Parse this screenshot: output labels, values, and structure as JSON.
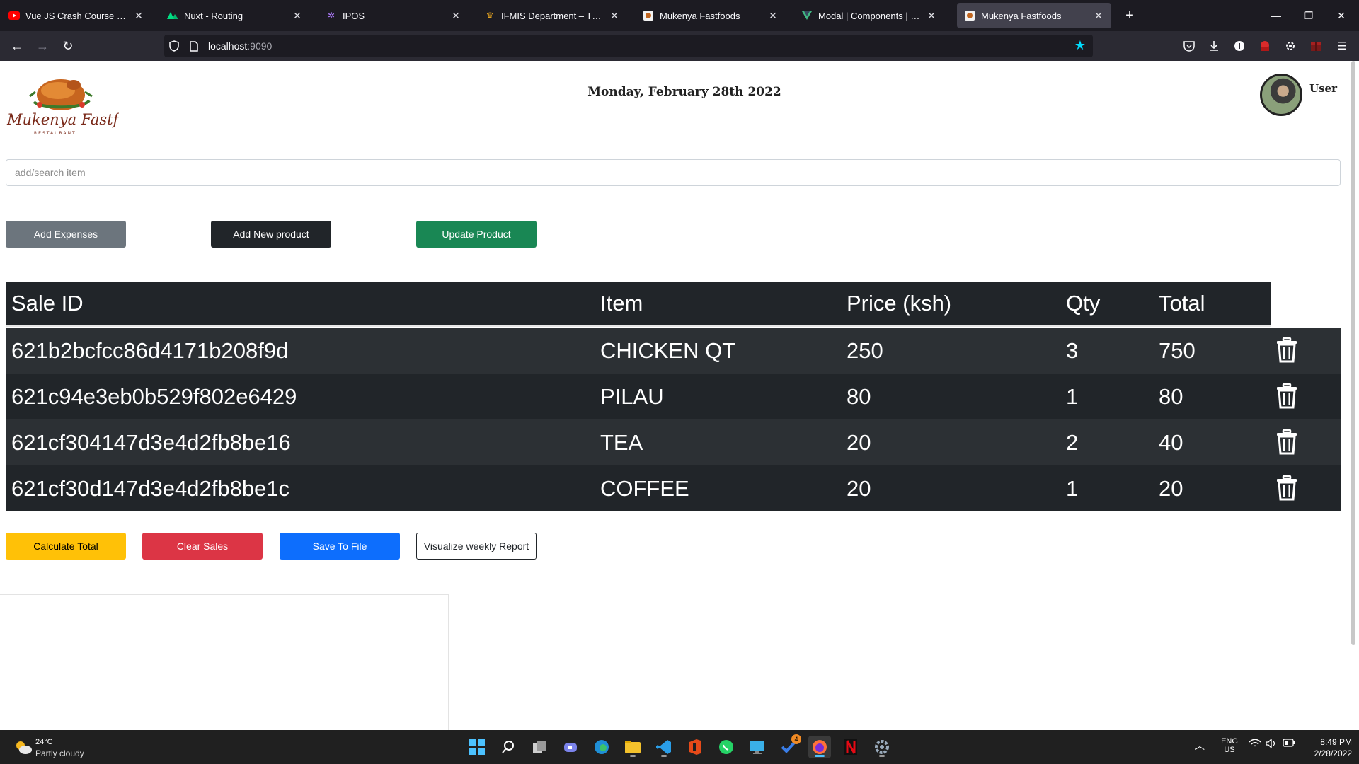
{
  "browser": {
    "tabs": [
      {
        "title": "Vue JS Crash Course - YouTube",
        "icon": "youtube-icon",
        "active": false
      },
      {
        "title": "Nuxt - Routing",
        "icon": "nuxt-icon",
        "active": false
      },
      {
        "title": "IPOS",
        "icon": "ipos-icon",
        "active": false
      },
      {
        "title": "IFMIS Department – The National",
        "icon": "ifmis-icon",
        "active": false
      },
      {
        "title": "Mukenya Fastfoods",
        "icon": "mukenya-icon",
        "active": false
      },
      {
        "title": "Modal | Components | Bootstrap",
        "icon": "vue-icon",
        "active": false
      },
      {
        "title": "Mukenya Fastfoods",
        "icon": "mukenya-icon",
        "active": true
      }
    ],
    "url_host": "localhost",
    "url_port": ":9090"
  },
  "header": {
    "logo_name": "Mukenya Fastfood",
    "logo_sub": "RESTAURANT",
    "date": "Monday, February 28th 2022",
    "user_label": "User"
  },
  "search": {
    "placeholder": "add/search item"
  },
  "actions": {
    "add_expenses": "Add Expenses",
    "add_new_product": "Add New product",
    "update_product": "Update Product"
  },
  "table": {
    "columns": [
      "Sale ID",
      "Item",
      "Price (ksh)",
      "Qty",
      "Total"
    ],
    "rows": [
      {
        "sale_id": "621b2bcfcc86d4171b208f9d",
        "item": "CHICKEN QT",
        "price": "250",
        "qty": "3",
        "total": "750"
      },
      {
        "sale_id": "621c94e3eb0b529f802e6429",
        "item": "PILAU",
        "price": "80",
        "qty": "1",
        "total": "80"
      },
      {
        "sale_id": "621cf304147d3e4d2fb8be16",
        "item": "TEA",
        "price": "20",
        "qty": "2",
        "total": "40"
      },
      {
        "sale_id": "621cf30d147d3e4d2fb8be1c",
        "item": "COFFEE",
        "price": "20",
        "qty": "1",
        "total": "20"
      }
    ]
  },
  "footer_actions": {
    "calculate_total": "Calculate Total",
    "clear_sales": "Clear Sales",
    "save_to_file": "Save To File",
    "visualize_report": "Visualize weekly Report"
  },
  "taskbar": {
    "weather_temp": "24°C",
    "weather_desc": "Partly cloudy",
    "lang_top": "ENG",
    "lang_bottom": "US",
    "time": "8:49 PM",
    "date": "2/28/2022",
    "badge_count": "4"
  },
  "colors": {
    "accent_star": "#00ddff",
    "table_dark": "#212529",
    "btn_success": "#198754",
    "btn_warning": "#ffc107",
    "btn_danger": "#dc3545",
    "btn_primary": "#0d6efd"
  }
}
